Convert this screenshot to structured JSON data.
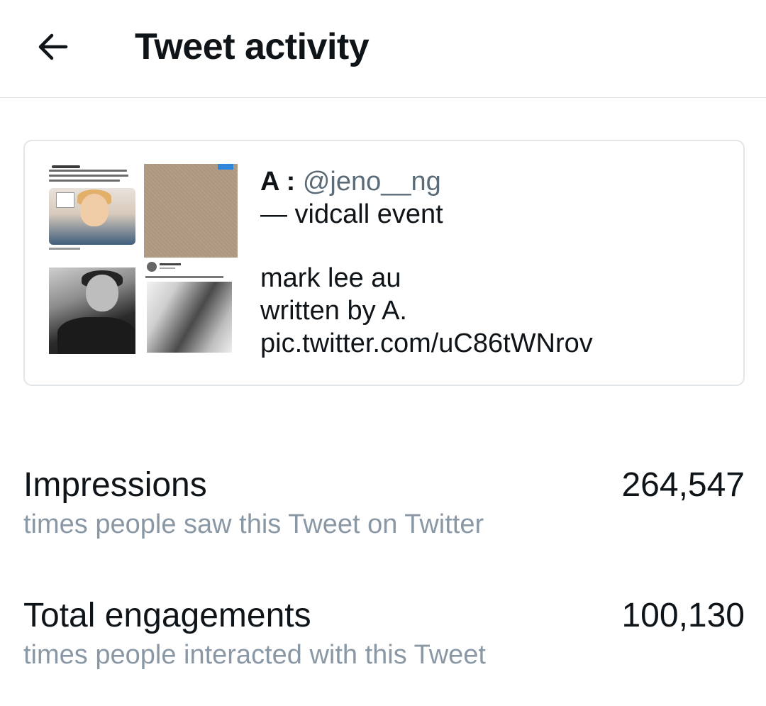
{
  "header": {
    "back_icon": "arrow-left-icon",
    "title": "Tweet activity"
  },
  "tweet": {
    "author": "A :",
    "handle": "@jeno__ng",
    "line1": "— vidcall event",
    "line2": "mark lee au",
    "line3": "written by A.",
    "link": "pic.twitter.com/uC86tWNrov"
  },
  "stats": [
    {
      "label": "Impressions",
      "description": "times people saw this Tweet on Twitter",
      "value": "264,547"
    },
    {
      "label": "Total engagements",
      "description": "times people interacted with this Tweet",
      "value": "100,130"
    }
  ]
}
